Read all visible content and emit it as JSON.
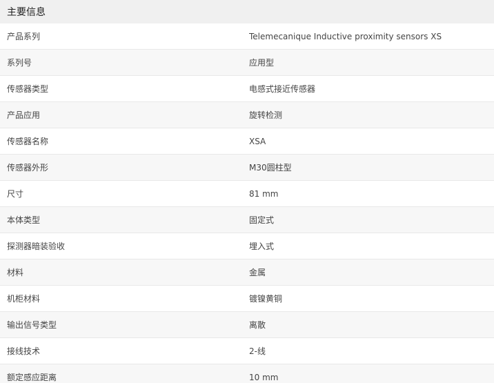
{
  "section": {
    "title": "主要信息"
  },
  "rows": [
    {
      "label": "产品系列",
      "value": "Telemecanique Inductive proximity sensors XS"
    },
    {
      "label": "系列号",
      "value": "应用型"
    },
    {
      "label": "传感器类型",
      "value": "电感式接近传感器"
    },
    {
      "label": "产品应用",
      "value": "旋转检测"
    },
    {
      "label": "传感器名称",
      "value": "XSA"
    },
    {
      "label": "传感器外形",
      "value": "M30圆柱型"
    },
    {
      "label": "尺寸",
      "value": "81 mm"
    },
    {
      "label": "本体类型",
      "value": "固定式"
    },
    {
      "label": "探测器暗装验收",
      "value": "埋入式"
    },
    {
      "label": "材料",
      "value": "金属"
    },
    {
      "label": "机柜材料",
      "value": "镀镍黄铜"
    },
    {
      "label": "输出信号类型",
      "value": "离散"
    },
    {
      "label": "接线技术",
      "value": "2-线"
    },
    {
      "label": "额定感应距离",
      "value": "10 mm"
    }
  ]
}
